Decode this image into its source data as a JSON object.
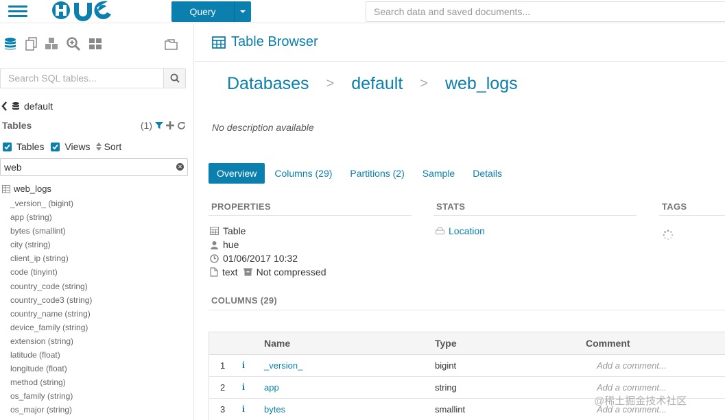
{
  "topbar": {
    "logo_text": "HUE",
    "query_label": "Query",
    "search_placeholder": "Search data and saved documents..."
  },
  "leftpanel": {
    "search_placeholder": "Search SQL tables...",
    "database": "default",
    "tables_heading": "Tables",
    "tables_count": "(1)",
    "filter_tables": "Tables",
    "filter_views": "Views",
    "sort_label": "Sort",
    "filter_value": "web",
    "table_name": "web_logs",
    "columns": [
      "_version_ (bigint)",
      "app (string)",
      "bytes (smallint)",
      "city (string)",
      "client_ip (string)",
      "code (tinyint)",
      "country_code (string)",
      "country_code3 (string)",
      "country_name (string)",
      "device_family (string)",
      "extension (string)",
      "latitude (float)",
      "longitude (float)",
      "method (string)",
      "os_family (string)",
      "os_major (string)"
    ]
  },
  "content": {
    "header_title": "Table Browser",
    "breadcrumb": [
      "Databases",
      "default",
      "web_logs"
    ],
    "breadcrumb_sep": ">",
    "description": "No description available",
    "tabs": [
      "Overview",
      "Columns (29)",
      "Partitions (2)",
      "Sample",
      "Details"
    ],
    "properties_heading": "PROPERTIES",
    "stats_heading": "STATS",
    "tags_heading": "TAGS",
    "prop_type": "Table",
    "prop_owner": "hue",
    "prop_date": "01/06/2017 10:32",
    "prop_format": "text",
    "prop_compression": "Not compressed",
    "location_label": "Location",
    "columns_heading": "COLUMNS (29)",
    "table_headers": {
      "name": "Name",
      "type": "Type",
      "comment": "Comment"
    },
    "rows": [
      {
        "num": "1",
        "info": "i",
        "name": "_version_",
        "type": "bigint",
        "comment": "Add a comment..."
      },
      {
        "num": "2",
        "info": "i",
        "name": "app",
        "type": "string",
        "comment": "Add a comment..."
      },
      {
        "num": "3",
        "info": "i",
        "name": "bytes",
        "type": "smallint",
        "comment": "Add a comment..."
      }
    ]
  },
  "watermark": "@稀土掘金技术社区",
  "colors": {
    "accent": "#0B7FAD",
    "muted": "#777777",
    "border": "#e5e5e5"
  }
}
